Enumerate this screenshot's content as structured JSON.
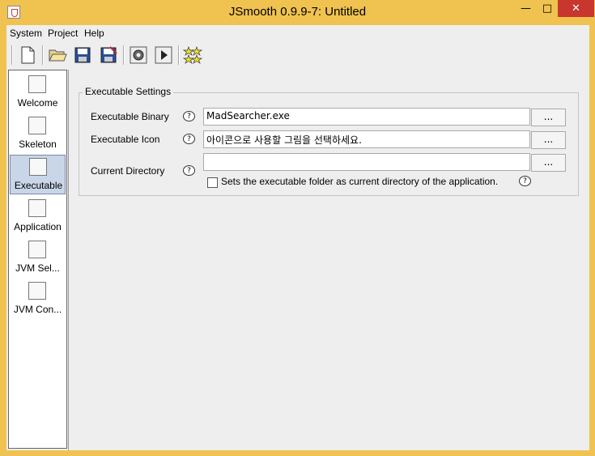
{
  "window": {
    "title": "JSmooth 0.9.9-7: Untitled",
    "min": "—",
    "max": "□",
    "close": "✕"
  },
  "menu": [
    "System",
    "Project",
    "Help"
  ],
  "toolbar": {
    "buttons": [
      "new-icon",
      "open-icon",
      "save-icon",
      "save-as-icon",
      "compile-icon",
      "run-icon",
      "about-icon"
    ]
  },
  "sidebar": {
    "items": [
      {
        "label": "Welcome",
        "icon": "welcome-icon"
      },
      {
        "label": "Skeleton",
        "icon": "skeleton-icon"
      },
      {
        "label": "Executable",
        "icon": "executable-icon",
        "selected": true
      },
      {
        "label": "Application",
        "icon": "application-icon"
      },
      {
        "label": "JVM Sel...",
        "icon": "jvm-selection-icon"
      },
      {
        "label": "JVM Con...",
        "icon": "jvm-configuration-icon"
      }
    ]
  },
  "executable_settings": {
    "title": "Executable Settings",
    "binary_label": "Executable Binary",
    "binary_value": "MadSearcher.exe",
    "icon_label": "Executable Icon",
    "icon_value": "아이콘으로 사용할 그림을 선택하세요.",
    "dir_label": "Current Directory",
    "dir_value": "",
    "browse_label": "...",
    "help_glyph": "?",
    "checkbox_label": "Sets the executable folder as current directory of the application."
  }
}
